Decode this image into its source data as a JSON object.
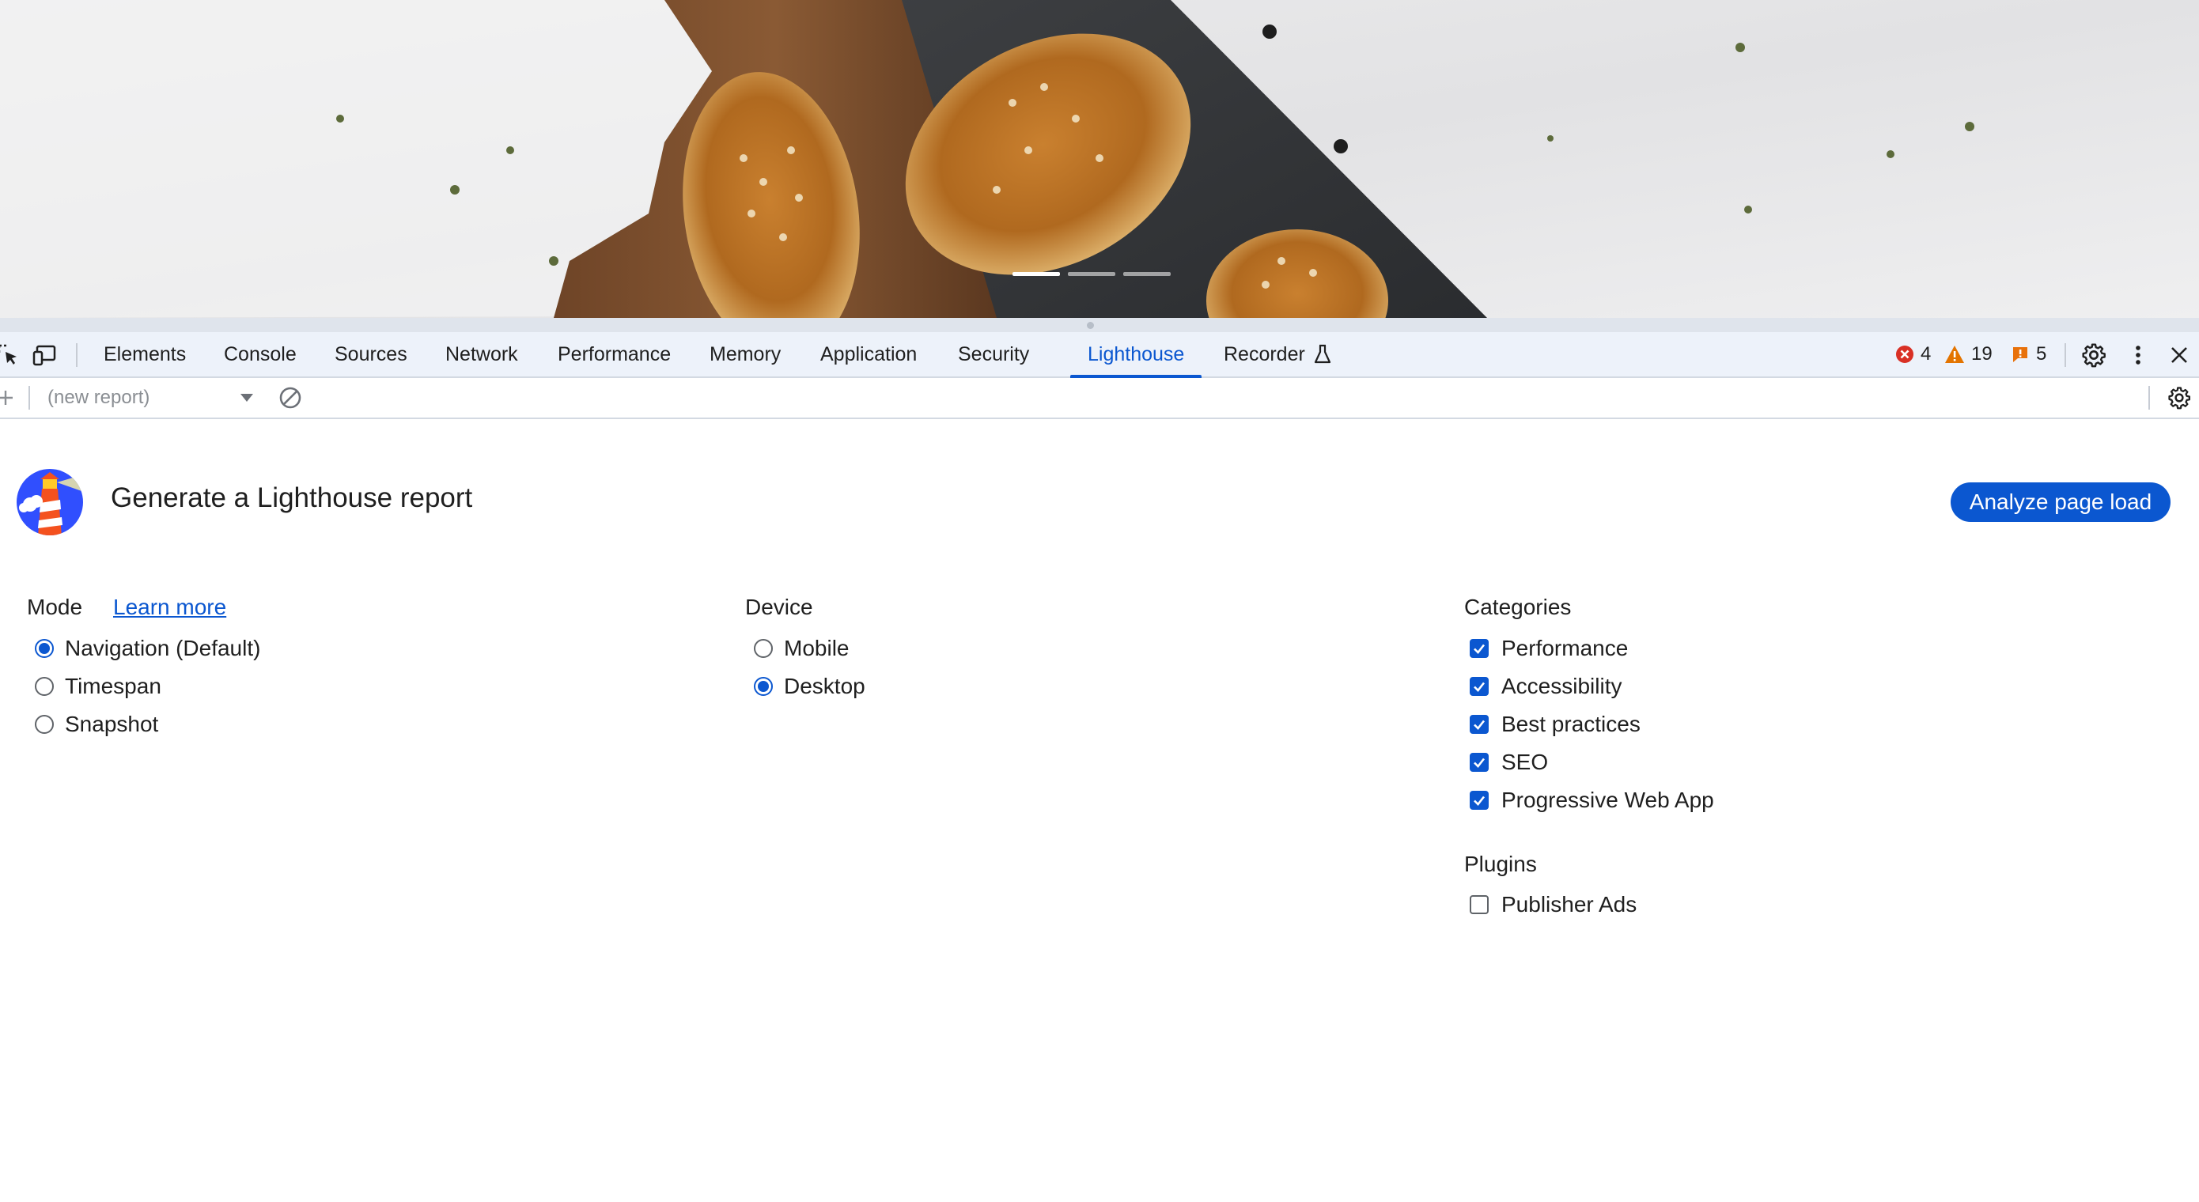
{
  "page": {
    "hero_image": "bread-rolls-on-cutting-board",
    "carousel": {
      "slides": 3,
      "active": 1
    }
  },
  "devtools": {
    "tabs": [
      {
        "label": "Elements"
      },
      {
        "label": "Console"
      },
      {
        "label": "Sources"
      },
      {
        "label": "Network"
      },
      {
        "label": "Performance"
      },
      {
        "label": "Memory"
      },
      {
        "label": "Application"
      },
      {
        "label": "Security"
      },
      {
        "label": "Lighthouse"
      },
      {
        "label": "Recorder"
      }
    ],
    "active_tab": "Lighthouse",
    "counters": {
      "errors": "4",
      "warnings": "19",
      "issues": "5"
    },
    "report_select": {
      "value": "(new report)"
    }
  },
  "lighthouse": {
    "title": "Generate a Lighthouse report",
    "analyze_button": "Analyze page load",
    "mode": {
      "heading": "Mode",
      "learn_more": "Learn more",
      "options": [
        {
          "label": "Navigation (Default)",
          "checked": true
        },
        {
          "label": "Timespan",
          "checked": false
        },
        {
          "label": "Snapshot",
          "checked": false
        }
      ]
    },
    "device": {
      "heading": "Device",
      "options": [
        {
          "label": "Mobile",
          "checked": false
        },
        {
          "label": "Desktop",
          "checked": true
        }
      ]
    },
    "categories": {
      "heading": "Categories",
      "options": [
        {
          "label": "Performance",
          "checked": true
        },
        {
          "label": "Accessibility",
          "checked": true
        },
        {
          "label": "Best practices",
          "checked": true
        },
        {
          "label": "SEO",
          "checked": true
        },
        {
          "label": "Progressive Web App",
          "checked": true
        }
      ]
    },
    "plugins": {
      "heading": "Plugins",
      "options": [
        {
          "label": "Publisher Ads",
          "checked": false
        }
      ]
    }
  },
  "colors": {
    "accent": "#0b57d0",
    "tabbar_bg": "#edf2fa",
    "error": "#d93025",
    "warning": "#e37400",
    "issue": "#e8710a"
  }
}
